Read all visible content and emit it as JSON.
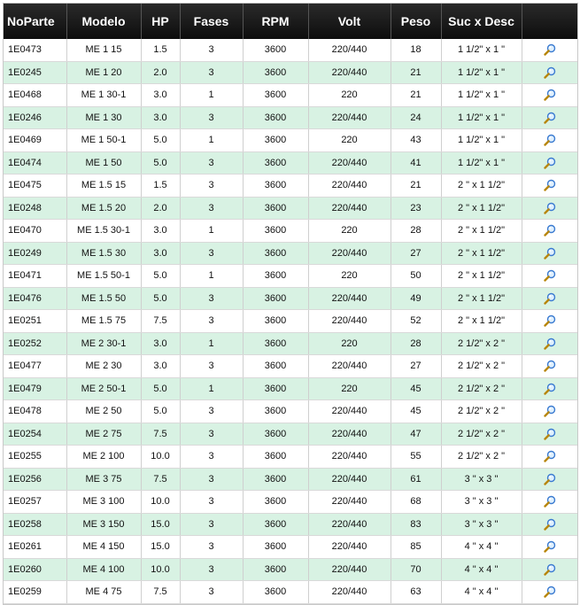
{
  "table": {
    "headers": [
      "NoParte",
      "Modelo",
      "HP",
      "Fases",
      "RPM",
      "Volt",
      "Peso",
      "Suc x Desc"
    ],
    "action_icon": "magnifier-icon",
    "rows": [
      [
        "1E0473",
        "ME 1 15",
        "1.5",
        "3",
        "3600",
        "220/440",
        "18",
        "1 1/2\" x  1 \""
      ],
      [
        "1E0245",
        "ME 1 20",
        "2.0",
        "3",
        "3600",
        "220/440",
        "21",
        "1 1/2\" x  1 \""
      ],
      [
        "1E0468",
        "ME 1 30-1",
        "3.0",
        "1",
        "3600",
        "220",
        "21",
        "1 1/2\" x  1 \""
      ],
      [
        "1E0246",
        "ME 1 30",
        "3.0",
        "3",
        "3600",
        "220/440",
        "24",
        "1 1/2\" x  1 \""
      ],
      [
        "1E0469",
        "ME 1 50-1",
        "5.0",
        "1",
        "3600",
        "220",
        "43",
        "1 1/2\" x  1 \""
      ],
      [
        "1E0474",
        "ME 1 50",
        "5.0",
        "3",
        "3600",
        "220/440",
        "41",
        "1 1/2\" x  1 \""
      ],
      [
        "1E0475",
        "ME 1.5 15",
        "1.5",
        "3",
        "3600",
        "220/440",
        "21",
        "2 \" x  1 1/2\""
      ],
      [
        "1E0248",
        "ME 1.5 20",
        "2.0",
        "3",
        "3600",
        "220/440",
        "23",
        "2 \" x  1 1/2\""
      ],
      [
        "1E0470",
        "ME 1.5 30-1",
        "3.0",
        "1",
        "3600",
        "220",
        "28",
        "2 \" x  1 1/2\""
      ],
      [
        "1E0249",
        "ME 1.5 30",
        "3.0",
        "3",
        "3600",
        "220/440",
        "27",
        "2 \" x  1 1/2\""
      ],
      [
        "1E0471",
        "ME 1.5 50-1",
        "5.0",
        "1",
        "3600",
        "220",
        "50",
        "2 \" x  1 1/2\""
      ],
      [
        "1E0476",
        "ME 1.5 50",
        "5.0",
        "3",
        "3600",
        "220/440",
        "49",
        "2 \" x  1 1/2\""
      ],
      [
        "1E0251",
        "ME 1.5 75",
        "7.5",
        "3",
        "3600",
        "220/440",
        "52",
        "2 \" x  1 1/2\""
      ],
      [
        "1E0252",
        "ME 2 30-1",
        "3.0",
        "1",
        "3600",
        "220",
        "28",
        "2 1/2\" x  2 \""
      ],
      [
        "1E0477",
        "ME 2 30",
        "3.0",
        "3",
        "3600",
        "220/440",
        "27",
        "2 1/2\" x  2 \""
      ],
      [
        "1E0479",
        "ME 2 50-1",
        "5.0",
        "1",
        "3600",
        "220",
        "45",
        "2 1/2\" x  2 \""
      ],
      [
        "1E0478",
        "ME 2 50",
        "5.0",
        "3",
        "3600",
        "220/440",
        "45",
        "2 1/2\" x  2 \""
      ],
      [
        "1E0254",
        "ME 2 75",
        "7.5",
        "3",
        "3600",
        "220/440",
        "47",
        "2 1/2\" x  2 \""
      ],
      [
        "1E0255",
        "ME 2 100",
        "10.0",
        "3",
        "3600",
        "220/440",
        "55",
        "2 1/2\" x  2 \""
      ],
      [
        "1E0256",
        "ME 3 75",
        "7.5",
        "3",
        "3600",
        "220/440",
        "61",
        "3 \" x  3 \""
      ],
      [
        "1E0257",
        "ME 3 100",
        "10.0",
        "3",
        "3600",
        "220/440",
        "68",
        "3 \" x  3 \""
      ],
      [
        "1E0258",
        "ME 3 150",
        "15.0",
        "3",
        "3600",
        "220/440",
        "83",
        "3 \" x  3 \""
      ],
      [
        "1E0261",
        "ME 4 150",
        "15.0",
        "3",
        "3600",
        "220/440",
        "85",
        "4 \" x  4 \""
      ],
      [
        "1E0260",
        "ME 4 100",
        "10.0",
        "3",
        "3600",
        "220/440",
        "70",
        "4 \" x  4 \""
      ],
      [
        "1E0259",
        "ME 4 75",
        "7.5",
        "3",
        "3600",
        "220/440",
        "63",
        "4 \" x  4 \""
      ]
    ]
  },
  "colors": {
    "header_bg": "#111111",
    "row_alt": "#d8f2e3",
    "row": "#ffffff"
  }
}
